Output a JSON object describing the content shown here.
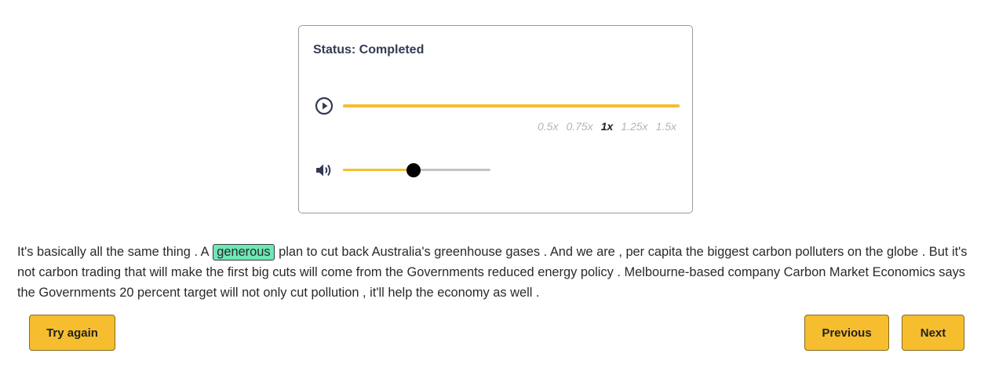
{
  "player": {
    "status": "Status: Completed",
    "progress": 1.0,
    "speeds": [
      "0.5x",
      "0.75x",
      "1x",
      "1.25x",
      "1.5x"
    ],
    "active_speed": "1x",
    "volume": 0.48,
    "colors": {
      "accent": "#f6be2f",
      "highlight": "#6ee7b7"
    }
  },
  "transcript": {
    "before": "It's basically all the same thing . A",
    "highlighted_word": "generous",
    "after": "plan to cut back Australia's greenhouse gases . And we are , per capita the biggest carbon polluters on the globe . But it's not carbon trading that will make the first big cuts will come from the Governments  reduced energy  policy . Melbourne-based  company Carbon Market Economics says the Governments 20 percent target will not only cut pollution , it'll help the economy as well ."
  },
  "buttons": {
    "try_again": "Try again",
    "previous": "Previous",
    "next": "Next"
  }
}
